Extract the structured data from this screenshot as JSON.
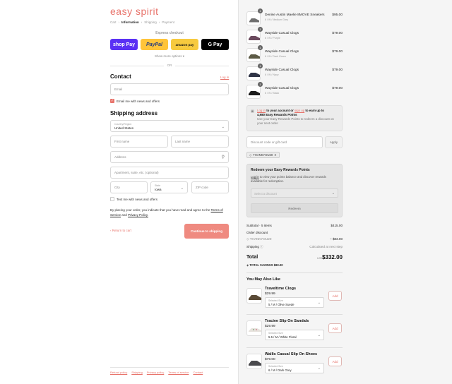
{
  "brand": {
    "logo": "easy spirit"
  },
  "breadcrumbs": [
    "Cart",
    "Information",
    "Shipping",
    "Payment"
  ],
  "express": {
    "title": "Express checkout",
    "buttons": {
      "shop": "shop Pay",
      "paypal": "PayPal",
      "amazon": "amazon pay",
      "gpay": "G Pay"
    },
    "more": "Show more options ▾",
    "or": "OR"
  },
  "contact": {
    "heading": "Contact",
    "login": "Log in",
    "email_placeholder": "Email",
    "news_label": "Email me with news and offers"
  },
  "shipping": {
    "heading": "Shipping address",
    "country_label": "Country/Region",
    "country_value": "United States",
    "first_name": "First name",
    "last_name": "Last name",
    "address": "Address",
    "apartment": "Apartment, suite, etc. (optional)",
    "city": "City",
    "state_label": "State",
    "state_value": "Iowa",
    "zip": "ZIP code",
    "text_label": "Text me with news and offers"
  },
  "terms": {
    "text": "By placing your order, you indicate that you have read and agree to the",
    "tos": "Terms of Service",
    "and": "and",
    "privacy": "Privacy Policy."
  },
  "actions": {
    "return": "Return to cart",
    "continue": "Continue to shipping"
  },
  "footer": [
    "Refund policy",
    "Shipping",
    "Privacy policy",
    "Terms of service",
    "Contact"
  ],
  "cart": [
    {
      "qty": "1",
      "name": "Denise Austin Maelie 8MOVE Sneakers",
      "variant": "6 / W / Medium Grey",
      "price": "$95.00"
    },
    {
      "qty": "1",
      "name": "Wayside Casual Clogs",
      "variant": "6 / W / Purple",
      "price": "$79.00"
    },
    {
      "qty": "1",
      "name": "Wayside Casual Clogs",
      "variant": "6 / W / Dark Green",
      "price": "$79.00"
    },
    {
      "qty": "1",
      "name": "Wayside Casual Clogs",
      "variant": "6 / W / Navy",
      "price": "$79.00"
    },
    {
      "qty": "1",
      "name": "Wayside Casual Clogs",
      "variant": "6 / W / Black",
      "price": "$79.00"
    }
  ],
  "rewards": {
    "login": "Log in",
    "mid": "to your account or",
    "signup": "sign up",
    "tail": "to earn up to",
    "points": "4,980 Easy Rewards Points",
    "note": "Use your Easy Rewards Points to redeem a discount on your next order."
  },
  "discount": {
    "placeholder": "Discount code or gift card",
    "apply": "Apply",
    "tag": "THANKYOU20"
  },
  "redeem": {
    "title": "Redeem your Easy Rewards Points",
    "login": "Log in",
    "desc": "to view your points balance and discover rewards available for redemption.",
    "select": "Select a discount",
    "button": "Redeem"
  },
  "summary": {
    "subtotal_label": "Subtotal · 5 items",
    "subtotal": "$415.00",
    "order_discount": "Order discount",
    "code": "THANKYOU20",
    "discount": "− $83.00",
    "shipping_label": "Shipping",
    "shipping_value": "Calculated at next step",
    "total_label": "Total",
    "currency": "USD",
    "total": "$332.00",
    "savings_label": "TOTAL SAVINGS",
    "savings": "$83.00"
  },
  "recommend": {
    "heading": "You May Also Like",
    "items": [
      {
        "name": "Traveltime Clogs",
        "price": "$29.99",
        "size_label": "Selected Size",
        "size": "5 / M / Olive Suede",
        "add": "Add"
      },
      {
        "name": "Traciee Slip On Sandals",
        "price": "$29.99",
        "size_label": "Selected Size",
        "size": "5.5 / M / White Floral",
        "add": "Add"
      },
      {
        "name": "Wallis Casual Slip On Shoes",
        "price": "$79.00",
        "size_label": "Selected Size",
        "size": "6 / M / Dark Grey",
        "add": "Add"
      }
    ]
  },
  "colors": {
    "accent": "#e8736b",
    "panel": "#f5f5f5"
  }
}
